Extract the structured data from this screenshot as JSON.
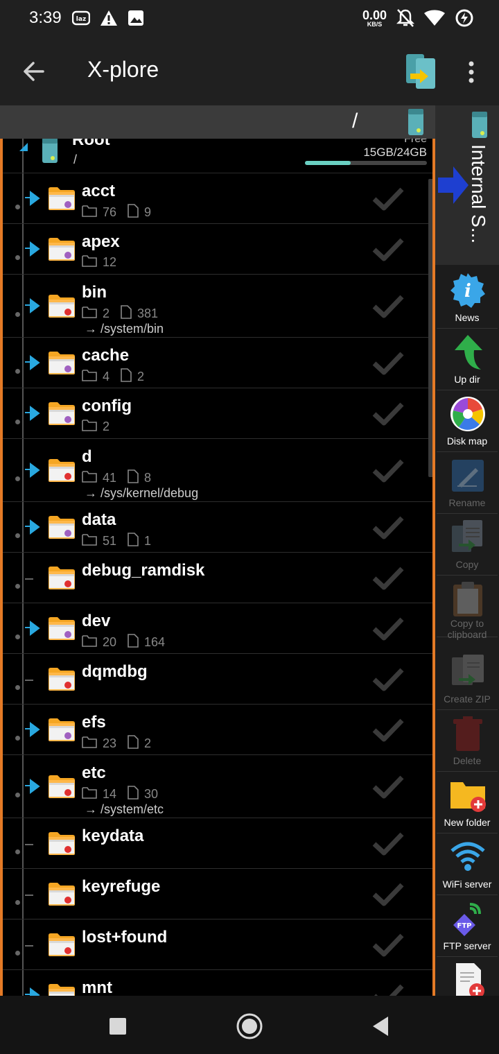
{
  "status_bar": {
    "time": "3:39",
    "speed_value": "0.00",
    "speed_unit": "KB/S",
    "icons": [
      "laz-icon",
      "warning-icon",
      "image-icon",
      "mute-icon",
      "wifi-icon",
      "battery-charging-icon"
    ]
  },
  "app_bar": {
    "title": "X-plore"
  },
  "path_bar": {
    "path": "/"
  },
  "root": {
    "name": "Root",
    "path": "/",
    "free_label": "Free",
    "size": "15GB/24GB",
    "usage_fraction": 0.375
  },
  "rows": [
    {
      "name": "acct",
      "dirs": "76",
      "files": "9",
      "link": "",
      "color": "#a060c0",
      "expand": true
    },
    {
      "name": "apex",
      "dirs": "12",
      "files": "",
      "link": "",
      "color": "#a060c0",
      "expand": true
    },
    {
      "name": "bin",
      "dirs": "2",
      "files": "381",
      "link": "→ /system/bin",
      "color": "#e03030",
      "expand": true
    },
    {
      "name": "cache",
      "dirs": "4",
      "files": "2",
      "link": "",
      "color": "#a060c0",
      "expand": true
    },
    {
      "name": "config",
      "dirs": "2",
      "files": "",
      "link": "",
      "color": "#a060c0",
      "expand": true
    },
    {
      "name": "d",
      "dirs": "41",
      "files": "8",
      "link": "→ /sys/kernel/debug",
      "color": "#e03030",
      "expand": true
    },
    {
      "name": "data",
      "dirs": "51",
      "files": "1",
      "link": "",
      "color": "#a060c0",
      "expand": true
    },
    {
      "name": "debug_ramdisk",
      "dirs": "",
      "files": "",
      "link": "",
      "color": "#e03030",
      "expand": false
    },
    {
      "name": "dev",
      "dirs": "20",
      "files": "164",
      "link": "",
      "color": "#a060c0",
      "expand": true
    },
    {
      "name": "dqmdbg",
      "dirs": "",
      "files": "",
      "link": "",
      "color": "#e03030",
      "expand": false
    },
    {
      "name": "efs",
      "dirs": "23",
      "files": "2",
      "link": "",
      "color": "#a060c0",
      "expand": true
    },
    {
      "name": "etc",
      "dirs": "14",
      "files": "30",
      "link": "→ /system/etc",
      "color": "#e03030",
      "expand": true
    },
    {
      "name": "keydata",
      "dirs": "",
      "files": "",
      "link": "",
      "color": "#e03030",
      "expand": false
    },
    {
      "name": "keyrefuge",
      "dirs": "",
      "files": "",
      "link": "",
      "color": "#e03030",
      "expand": false
    },
    {
      "name": "lost+found",
      "dirs": "",
      "files": "",
      "link": "",
      "color": "#e03030",
      "expand": false
    },
    {
      "name": "mnt",
      "dirs": "",
      "files": "",
      "link": "",
      "color": "#e03030",
      "expand": true
    }
  ],
  "side_tab": {
    "label": "Internal S..."
  },
  "toolbar": [
    {
      "id": "news",
      "label": "News",
      "enabled": true
    },
    {
      "id": "up-dir",
      "label": "Up dir",
      "enabled": true
    },
    {
      "id": "disk-map",
      "label": "Disk map",
      "enabled": true
    },
    {
      "id": "rename",
      "label": "Rename",
      "enabled": false
    },
    {
      "id": "copy",
      "label": "Copy",
      "enabled": false
    },
    {
      "id": "copy-to-clipboard",
      "label": "Copy to clipboard",
      "enabled": false
    },
    {
      "id": "create-zip",
      "label": "Create ZIP",
      "enabled": false
    },
    {
      "id": "delete",
      "label": "Delete",
      "enabled": false
    },
    {
      "id": "new-folder",
      "label": "New folder",
      "enabled": true
    },
    {
      "id": "wifi-server",
      "label": "WiFi server",
      "enabled": true
    },
    {
      "id": "ftp-server",
      "label": "FTP server",
      "enabled": true
    },
    {
      "id": "new-file",
      "label": "",
      "enabled": true
    }
  ],
  "colors": {
    "accent_orange": "#e47a26",
    "tree_arrow_blue": "#29a8e0",
    "usage_bar": "#6ad0c2"
  }
}
